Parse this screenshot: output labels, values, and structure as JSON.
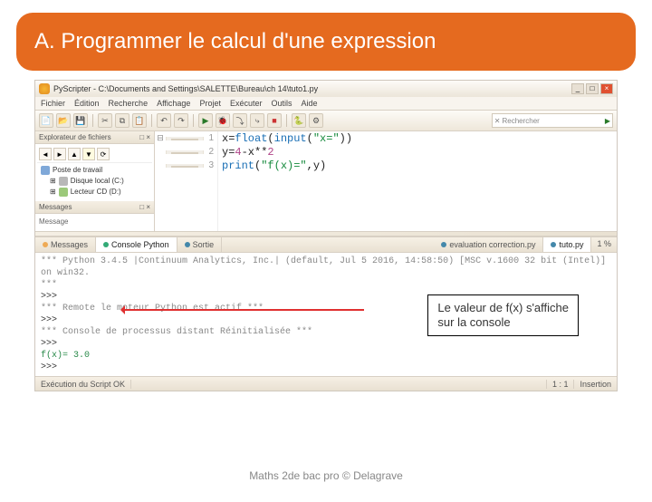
{
  "slide": {
    "title": "A. Programmer le calcul d'une expression",
    "footer": "Maths 2de bac pro © Delagrave"
  },
  "window": {
    "title": "PyScripter - C:\\Documents and Settings\\SALETTE\\Bureau\\ch 14\\tuto1.py"
  },
  "menu": [
    "Fichier",
    "Édition",
    "Recherche",
    "Affichage",
    "Projet",
    "Exécuter",
    "Outils",
    "Aide"
  ],
  "search": {
    "label": "Rechercher",
    "placeholder": ""
  },
  "sidebar": {
    "explorer_title": "Explorateur de fichiers",
    "messages_title": "Messages",
    "tree": [
      {
        "label": "Poste de travail"
      },
      {
        "label": "Disque local (C:)"
      },
      {
        "label": "Lecteur CD (D:)"
      }
    ]
  },
  "code": {
    "lines": [
      {
        "n": "1",
        "html": "x=<span class='fn'>float</span>(<span class='fn'>input</span>(<span class='str'>\"x=\"</span>))"
      },
      {
        "n": "2",
        "html": "y=<span class='op'>4</span>-x**<span class='op'>2</span>"
      },
      {
        "n": "3",
        "html": "<span class='kw'>print</span>(<span class='str'>\"f(x)=\"</span>,y)"
      }
    ]
  },
  "tabs": {
    "left": [
      "Messages",
      "Console Python",
      "Sortie"
    ],
    "files": [
      "evaluation correction.py",
      "tuto.py"
    ],
    "progress": "1 %"
  },
  "console": {
    "l1": "*** Python 3.4.5 |Continuum Analytics, Inc.| (default, Jul  5 2016, 14:58:50) [MSC v.1600 32 bit (Intel)] on win32.",
    "l2": "***",
    "l3": ">>>",
    "l4": "*** Remote le moteur Python  est actif ***",
    "l5": ">>>",
    "l6": "*** Console de processus distant Réinitialisée ***",
    "l7": ">>> ",
    "l8": "f(x)= 3.0",
    "l9": ">>> "
  },
  "callout": {
    "line1": "Le valeur de f(x) s'affiche",
    "line2": "sur la console"
  },
  "status": {
    "left": "Exécution du Script OK",
    "pos": "1 : 1",
    "mode": "Insertion"
  }
}
